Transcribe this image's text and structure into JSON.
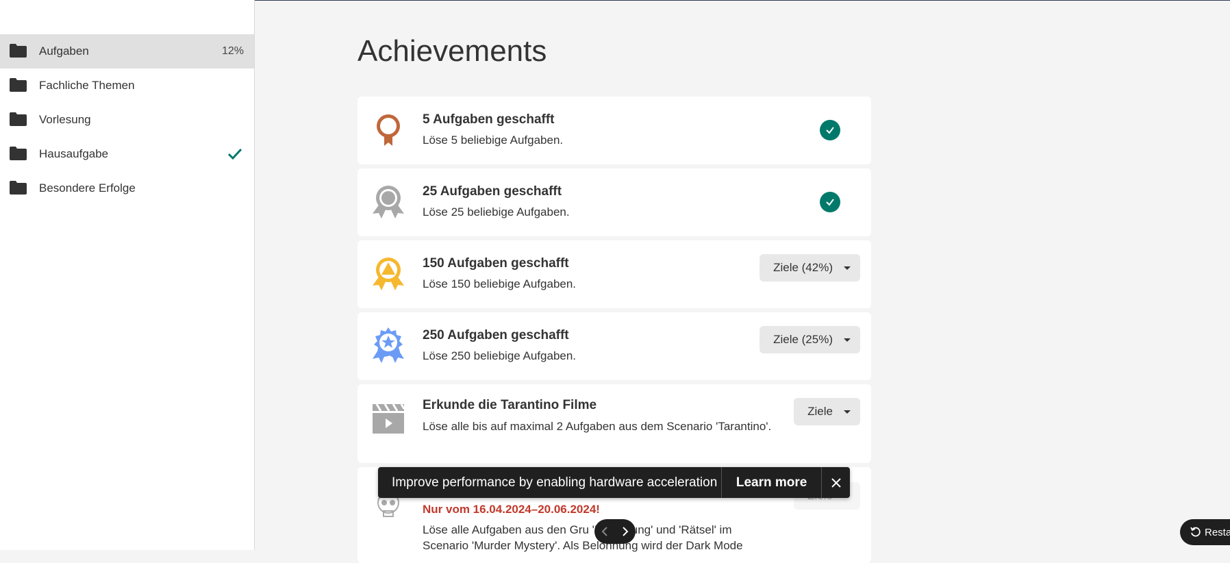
{
  "sidebar": {
    "items": [
      {
        "label": "Aufgaben",
        "value": "12%",
        "icon": "folder-icon",
        "active": true
      },
      {
        "label": "Fachliche Themen",
        "icon": "folder-icon"
      },
      {
        "label": "Vorlesung",
        "icon": "folder-icon"
      },
      {
        "label": "Hausaufgabe",
        "icon": "folder-icon",
        "status": "checkmark-icon"
      },
      {
        "label": "Besondere Erfolge",
        "icon": "folder-icon"
      }
    ]
  },
  "main": {
    "title": "Achievements",
    "cards": [
      {
        "title": "5 Aufgaben geschafft",
        "desc": "Löse 5 beliebige Aufgaben.",
        "icon": "bronze-medal-icon",
        "status": "completed"
      },
      {
        "title": "25 Aufgaben geschafft",
        "desc": "Löse 25 beliebige Aufgaben.",
        "icon": "silver-medal-icon",
        "status": "completed"
      },
      {
        "title": "150 Aufgaben geschafft",
        "desc": "Löse 150 beliebige Aufgaben.",
        "icon": "gold-medal-icon",
        "goal_label": "Ziele (42%)"
      },
      {
        "title": "250 Aufgaben geschafft",
        "desc": "Löse 250 beliebige Aufgaben.",
        "icon": "star-medal-icon",
        "goal_label": "Ziele (25%)"
      },
      {
        "title": "Erkunde die Tarantino Filme",
        "desc": "Löse alle bis auf maximal 2 Aufgaben aus dem Scenario 'Tarantino'.",
        "icon": "clapperboard-icon",
        "goal_label": "Ziele"
      },
      {
        "title": "",
        "date_note": "Nur vom 16.04.2024–20.06.2024!",
        "desc": "Löse alle  Aufgaben aus den Gru   'Einführung' und 'Rätsel' im Scenario 'Murder  Mystery'. Als Belohnung wird der Dark Mode",
        "icon": "skull-icon",
        "goal_label": "Ziele"
      }
    ]
  },
  "toast": {
    "message": "Improve performance by enabling hardware acceleration",
    "action": "Learn more"
  },
  "restart_label": "Resta",
  "colors": {
    "accent": "#00796b",
    "sidebar_active": "#e0e0e0",
    "red": "#c0392b",
    "bronze": "#c0673a",
    "silver": "#a8a8a8",
    "gold": "#f5b82e",
    "blue": "#6b9cf5"
  }
}
